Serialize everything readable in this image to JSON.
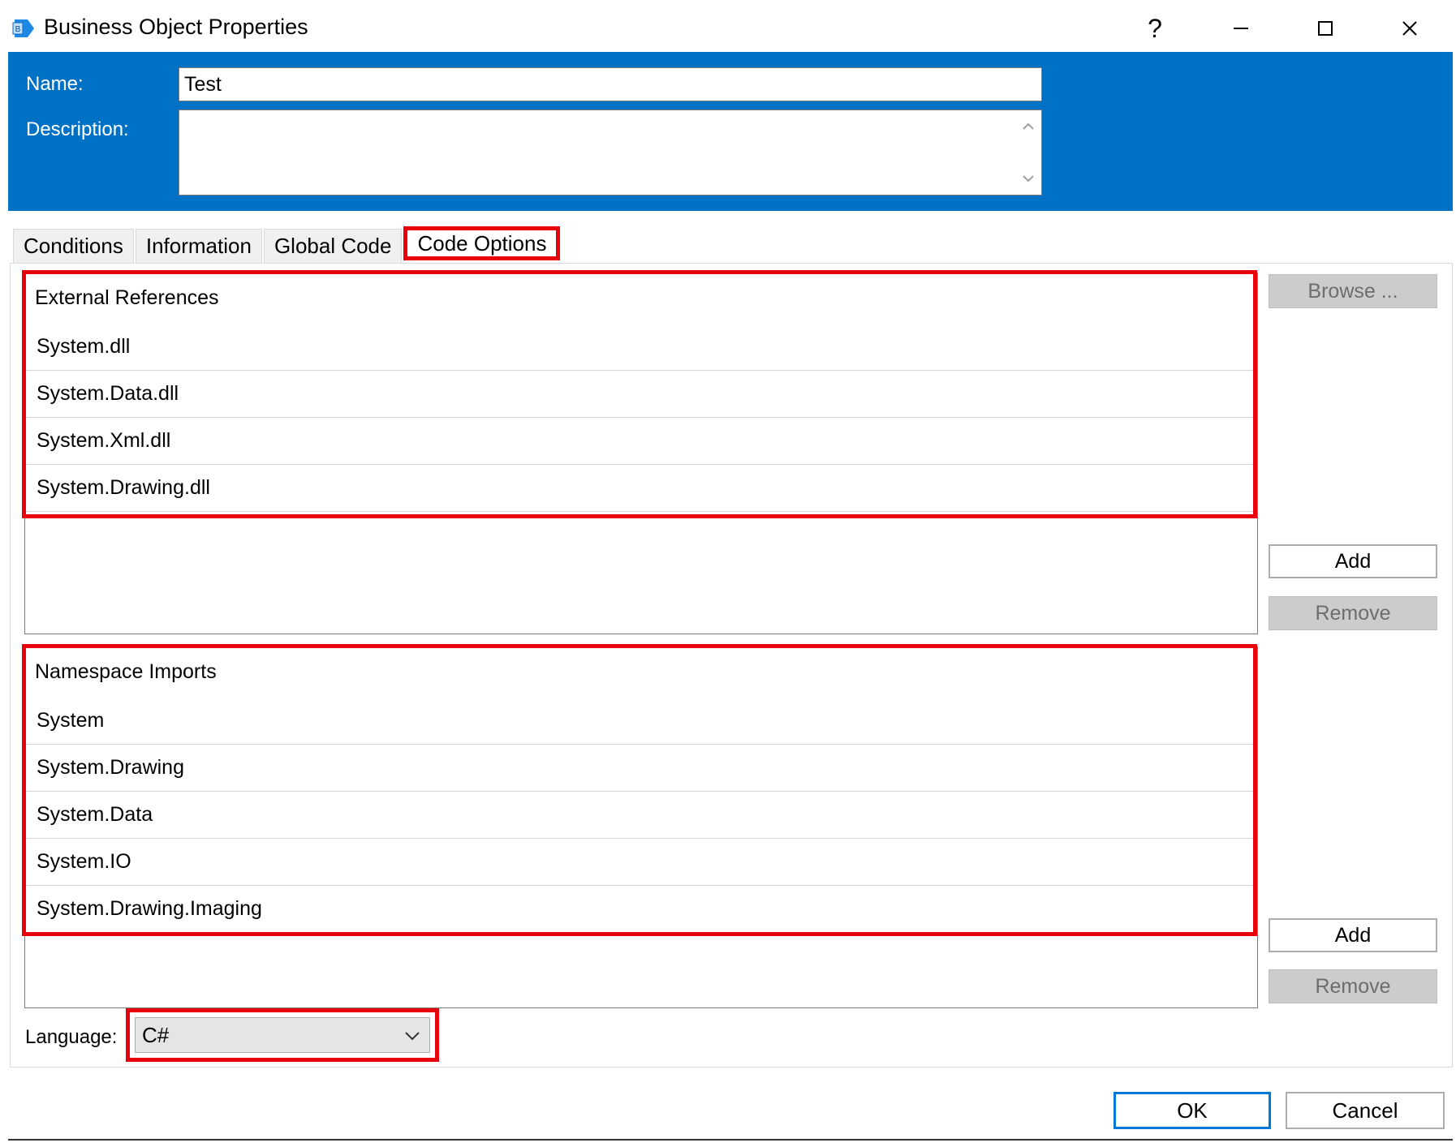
{
  "window": {
    "title": "Business Object Properties",
    "icon": "business-object-app-icon",
    "controls": {
      "help": "?",
      "minimize": "minimize-icon",
      "maximize": "maximize-icon",
      "close": "close-icon"
    }
  },
  "header": {
    "name_label": "Name:",
    "name_value": "Test",
    "description_label": "Description:",
    "description_value": ""
  },
  "tabs": [
    {
      "label": "Conditions",
      "active": false
    },
    {
      "label": "Information",
      "active": false
    },
    {
      "label": "Global Code",
      "active": false
    },
    {
      "label": "Code Options",
      "active": true
    }
  ],
  "external_references": {
    "header": "External References",
    "items": [
      "System.dll",
      "System.Data.dll",
      "System.Xml.dll",
      "System.Drawing.dll"
    ],
    "browse_label": "Browse ...",
    "add_label": "Add",
    "remove_label": "Remove"
  },
  "namespace_imports": {
    "header": "Namespace Imports",
    "items": [
      "System",
      "System.Drawing",
      "System.Data",
      "System.IO",
      "System.Drawing.Imaging"
    ],
    "add_label": "Add",
    "remove_label": "Remove"
  },
  "language": {
    "label": "Language:",
    "selected": "C#"
  },
  "footer": {
    "ok_label": "OK",
    "cancel_label": "Cancel"
  },
  "colors": {
    "header_blue": "#0072c6",
    "highlight_red": "#e8000b",
    "ok_border": "#0078d7"
  }
}
